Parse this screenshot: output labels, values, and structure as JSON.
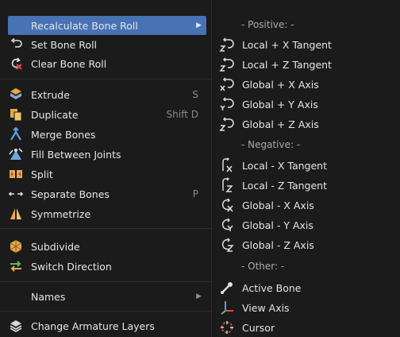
{
  "left_menu": {
    "items": [
      {
        "label": "Recalculate Bone Roll",
        "shortcut": "",
        "submenu": true,
        "highlighted": true,
        "icon": "none"
      },
      {
        "label": "Set Bone Roll",
        "shortcut": "",
        "icon": "roll-arrow-icon"
      },
      {
        "label": "Clear Bone Roll",
        "shortcut": "",
        "icon": "clear-roll-icon"
      },
      {
        "label": "Extrude",
        "shortcut": "S",
        "icon": "extrude-icon"
      },
      {
        "label": "Duplicate",
        "shortcut": "Shift D",
        "icon": "duplicate-icon"
      },
      {
        "label": "Merge Bones",
        "shortcut": "",
        "icon": "merge-bones-icon"
      },
      {
        "label": "Fill Between Joints",
        "shortcut": "",
        "icon": "fill-joints-icon"
      },
      {
        "label": "Split",
        "shortcut": "",
        "icon": "split-icon"
      },
      {
        "label": "Separate Bones",
        "shortcut": "P",
        "icon": "separate-icon"
      },
      {
        "label": "Symmetrize",
        "shortcut": "",
        "icon": "symmetrize-icon"
      },
      {
        "label": "Subdivide",
        "shortcut": "",
        "icon": "subdivide-icon"
      },
      {
        "label": "Switch Direction",
        "shortcut": "",
        "icon": "switch-direction-icon"
      },
      {
        "label": "Names",
        "shortcut": "",
        "submenu": true,
        "icon": "none"
      },
      {
        "label": "Change Armature Layers",
        "shortcut": "",
        "icon": "layers-icon"
      }
    ]
  },
  "right_menu": {
    "headers": [
      "- Positive: -",
      "- Negative: -",
      "- Other: -"
    ],
    "items": [
      {
        "label": "Local + X Tangent",
        "icon": "roll-z-icon"
      },
      {
        "label": "Local + Z Tangent",
        "icon": "roll-z-icon"
      },
      {
        "label": "Global + X Axis",
        "icon": "roll-x-icon"
      },
      {
        "label": "Global + Y Axis",
        "icon": "roll-y-icon"
      },
      {
        "label": "Global + Z Axis",
        "icon": "roll-z-icon"
      },
      {
        "label": "Local - X Tangent",
        "icon": "roll-neg-x-icon"
      },
      {
        "label": "Local - Z Tangent",
        "icon": "roll-neg-z-icon"
      },
      {
        "label": "Global - X Axis",
        "icon": "roll-neg-x-icon"
      },
      {
        "label": "Global - Y Axis",
        "icon": "roll-neg-y-icon"
      },
      {
        "label": "Global - Z Axis",
        "icon": "roll-neg-z-icon"
      },
      {
        "label": "Active Bone",
        "icon": "active-bone-icon"
      },
      {
        "label": "View Axis",
        "icon": "view-axis-icon"
      },
      {
        "label": "Cursor",
        "icon": "cursor-icon"
      }
    ]
  },
  "colors": {
    "background": "#1b1b1b",
    "highlight": "#4772b3",
    "text": "#e6e6e6",
    "shortcut": "#8a8a8a"
  }
}
